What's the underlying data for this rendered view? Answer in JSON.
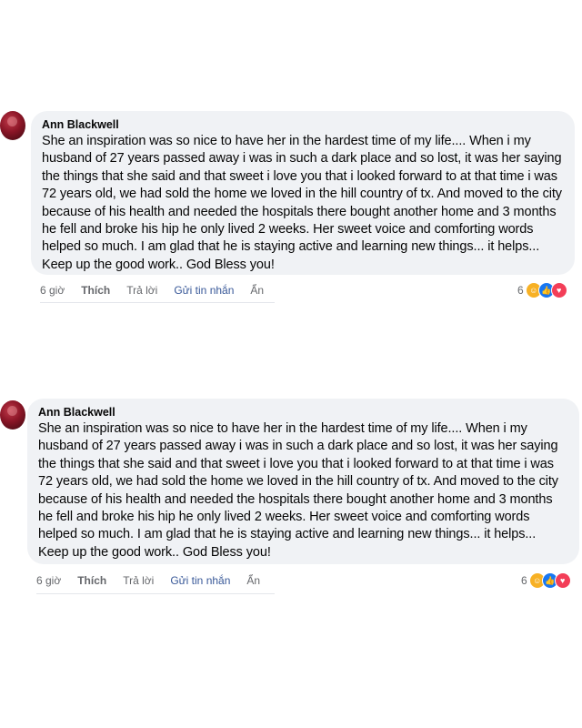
{
  "comments": [
    {
      "author": "Ann Blackwell",
      "text": "She an inspiration was so nice to have her in the hardest time of my life.... When i my husband of 27 years passed away i was in such a dark place and so lost, it was her saying the things that she said and that sweet i love you that i looked forward to at that time i was 72 years old, we had sold the home we loved in the hill country of tx. And moved to the city because of his health and needed the hospitals there bought another home and 3 months he fell and broke his hip he only lived 2 weeks. Her sweet voice and comforting words helped so much. I am glad that he is staying active and learning new things... it helps... Keep up the good work.. God Bless you!",
      "time": "6 giờ",
      "like_label": "Thích",
      "reply_label": "Trả lời",
      "message_label": "Gửi tin nhắn",
      "hide_label": "Ẩn",
      "reaction_count": "6",
      "reactions": [
        "care-icon",
        "like-icon",
        "love-icon"
      ]
    },
    {
      "author": "Ann Blackwell",
      "text": "She an inspiration was so nice to have her in the hardest time of my life.... When i my husband of 27 years passed away i was in such a dark place and so lost, it was her saying the things that she said and that sweet i love you that i looked forward to at that time i was 72 years old, we had sold the home we loved in the hill country of tx. And moved to the city because of his health and needed the hospitals there bought another home and 3 months he fell and broke his hip he only lived 2 weeks. Her sweet voice and comforting words helped so much. I am glad that he is staying active and learning new things... it helps... Keep up the good work.. God Bless you!",
      "time": "6 giờ",
      "like_label": "Thích",
      "reply_label": "Trả lời",
      "message_label": "Gửi tin nhắn",
      "hide_label": "Ẩn",
      "reaction_count": "6",
      "reactions": [
        "care-icon",
        "like-icon",
        "love-icon"
      ]
    }
  ]
}
